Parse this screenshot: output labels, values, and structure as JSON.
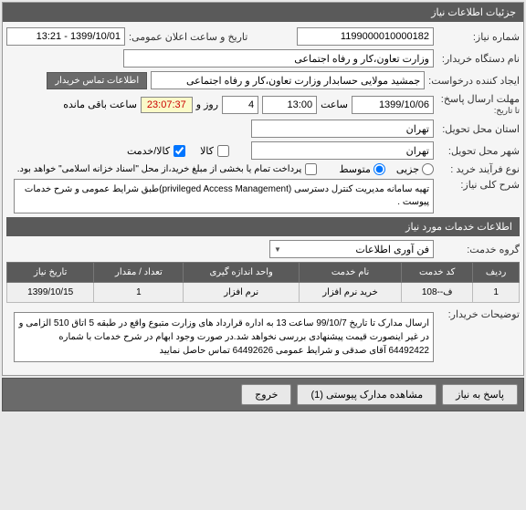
{
  "header": {
    "title": "جزئیات اطلاعات نیاز"
  },
  "form": {
    "need_number_label": "شماره نیاز:",
    "need_number": "1199000010000182",
    "announce_datetime_label": "تاریخ و ساعت اعلان عمومی:",
    "announce_datetime": "1399/10/01 - 13:21",
    "buyer_org_label": "نام دستگاه خریدار:",
    "buyer_org": "وزارت تعاون،کار و رفاه اجتماعی",
    "creator_label": "ایجاد کننده درخواست:",
    "creator": "جمشید مولایی حسابدار وزارت تعاون،کار و رفاه اجتماعی",
    "buyer_contact_button": "اطلاعات تماس خریدار",
    "deadline_label": "مهلت ارسال پاسخ:",
    "deadline_until_label": "تا تاریخ:",
    "deadline_date": "1399/10/06",
    "time_label": "ساعت",
    "deadline_time": "13:00",
    "days_label": "روز و",
    "days_value": "4",
    "countdown": "23:07:37",
    "remaining_label": "ساعت باقی مانده",
    "delivery_province_label": "استان محل تحویل:",
    "delivery_province": "تهران",
    "delivery_city_label": "شهر محل تحویل:",
    "delivery_city": "تهران",
    "goods_label": "کالا",
    "goods_service_label": "کالا/خدمت",
    "purchase_type_label": "نوع فرآیند خرید :",
    "radio_small": "جزیی",
    "radio_medium": "متوسط",
    "payment_note": "پرداخت تمام یا بخشی از مبلغ خرید،از محل \"اسناد خزانه اسلامی\" خواهد بود.",
    "need_desc_label": "شرح کلی نیاز:",
    "need_desc": "تهیه سامانه مدیریت کنترل دسترسی (privileged Access Management)طبق شرایط عمومی و شرح خدمات پیوست ."
  },
  "services_section": {
    "title": "اطلاعات خدمات مورد نیاز",
    "group_label": "گروه خدمت:",
    "group_value": "فن آوری اطلاعات"
  },
  "table": {
    "headers": {
      "row": "ردیف",
      "code": "کد خدمت",
      "name": "نام خدمت",
      "unit": "واحد اندازه گیری",
      "qty": "تعداد / مقدار",
      "date": "تاریخ نیاز"
    },
    "rows": [
      {
        "row": "1",
        "code": "ف--108",
        "name": "خرید نرم افزار",
        "unit": "نرم افزار",
        "qty": "1",
        "date": "1399/10/15"
      }
    ]
  },
  "buyer_notes": {
    "label": "توضیحات خریدار:",
    "text": "ارسال مدارک تا تاریخ 99/10/7 ساعت 13 به اداره قرارداد های وزارت متبوع واقع در طبقه 5 اتاق 510 الزامی و در غیر اینصورت قیمت پیشنهادی بررسی نخواهد شد.در صورت وجود ابهام در شرح خدمات با شماره 64492422 آقای صدقی و شرایط عمومی 64492626 تماس حاصل نمایید"
  },
  "buttons": {
    "reply": "پاسخ به نیاز",
    "attachments": "مشاهده مدارک پیوستی (1)",
    "exit": "خروج"
  }
}
